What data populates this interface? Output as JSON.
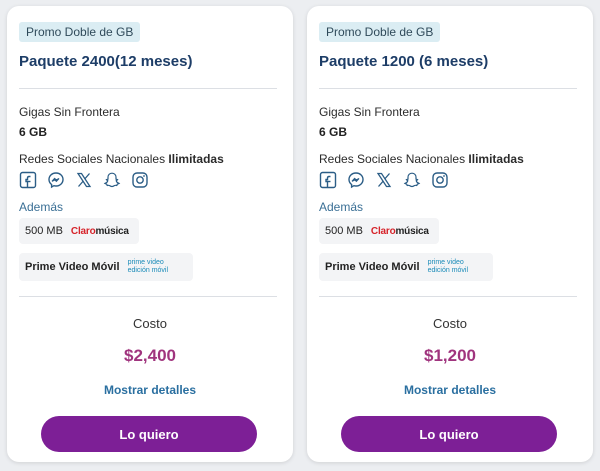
{
  "cards": [
    {
      "badge": "Promo Doble de GB",
      "title": "Paquete 2400(12 meses)",
      "gigas_label": "Gigas Sin Frontera",
      "gigas_value": "6 GB",
      "redes_label": "Redes Sociales Nacionales ",
      "redes_bold": "Ilimitadas",
      "ademas": "Además",
      "music_mb": "500 MB",
      "claro_brand": "Claro",
      "claro_service": "música",
      "prime_label": "Prime Video Móvil",
      "prime_logo": "prime video",
      "prime_edition": "edición móvil",
      "costo_label": "Costo",
      "price": "$2,400",
      "details_label": "Mostrar detalles",
      "cta_label": "Lo quiero"
    },
    {
      "badge": "Promo Doble de GB",
      "title": "Paquete 1200 (6 meses)",
      "gigas_label": "Gigas Sin Frontera",
      "gigas_value": "6 GB",
      "redes_label": "Redes Sociales Nacionales ",
      "redes_bold": "Ilimitadas",
      "ademas": "Además",
      "music_mb": "500 MB",
      "claro_brand": "Claro",
      "claro_service": "música",
      "prime_label": "Prime Video Móvil",
      "prime_logo": "prime video",
      "prime_edition": "edición móvil",
      "costo_label": "Costo",
      "price": "$1,200",
      "details_label": "Mostrar detalles",
      "cta_label": "Lo quiero"
    }
  ],
  "social_icons": [
    "facebook-icon",
    "messenger-icon",
    "x-icon",
    "snapchat-icon",
    "instagram-icon"
  ],
  "colors": {
    "title": "#1d3d67",
    "price": "#a0347e",
    "button": "#7d1f96",
    "link": "#2a6fa0",
    "badge_bg": "#dbedf3"
  }
}
